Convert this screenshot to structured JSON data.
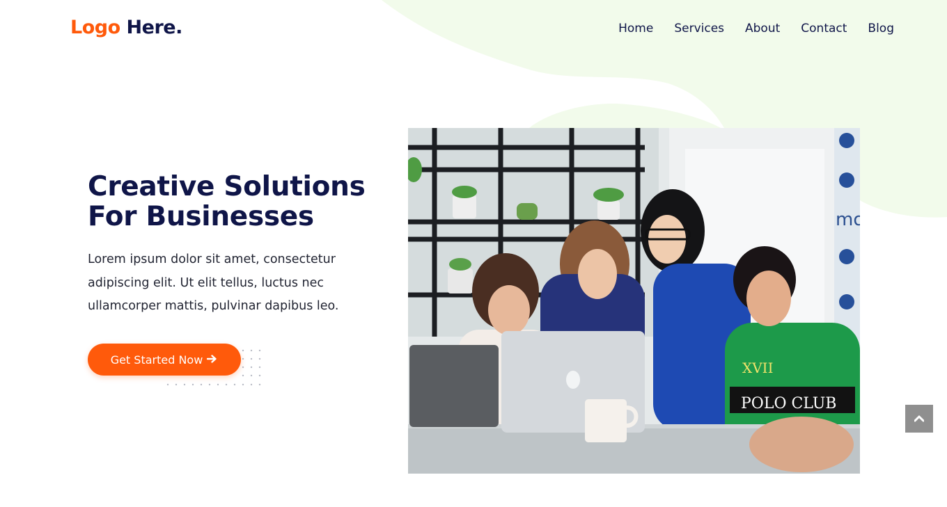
{
  "brand": {
    "logo_accent": "Logo",
    "logo_main": " Here.",
    "accent_color": "#ff5a0b",
    "primary_color": "#0f1548",
    "blob_color": "#f2fbeb"
  },
  "nav": {
    "items": [
      {
        "label": "Home"
      },
      {
        "label": "Services"
      },
      {
        "label": "About"
      },
      {
        "label": "Contact"
      },
      {
        "label": "Blog"
      }
    ]
  },
  "hero": {
    "title_line1": "Creative Solutions",
    "title_line2": "For Businesses",
    "description": "Lorem ipsum dolor sit amet, consectetur adipiscing elit. Ut elit tellus, luctus nec ullamcorper mattis, pulvinar dapibus leo.",
    "cta_label": "Get Started Now",
    "cta_icon": "arrow-right-icon",
    "image": {
      "subject": "team-working-on-laptop-photo",
      "shirt_text": "POLO CLUB",
      "shirt_number": "XVII",
      "wall_text": "mo"
    }
  },
  "scroll_top": {
    "icon": "chevron-up-icon"
  }
}
